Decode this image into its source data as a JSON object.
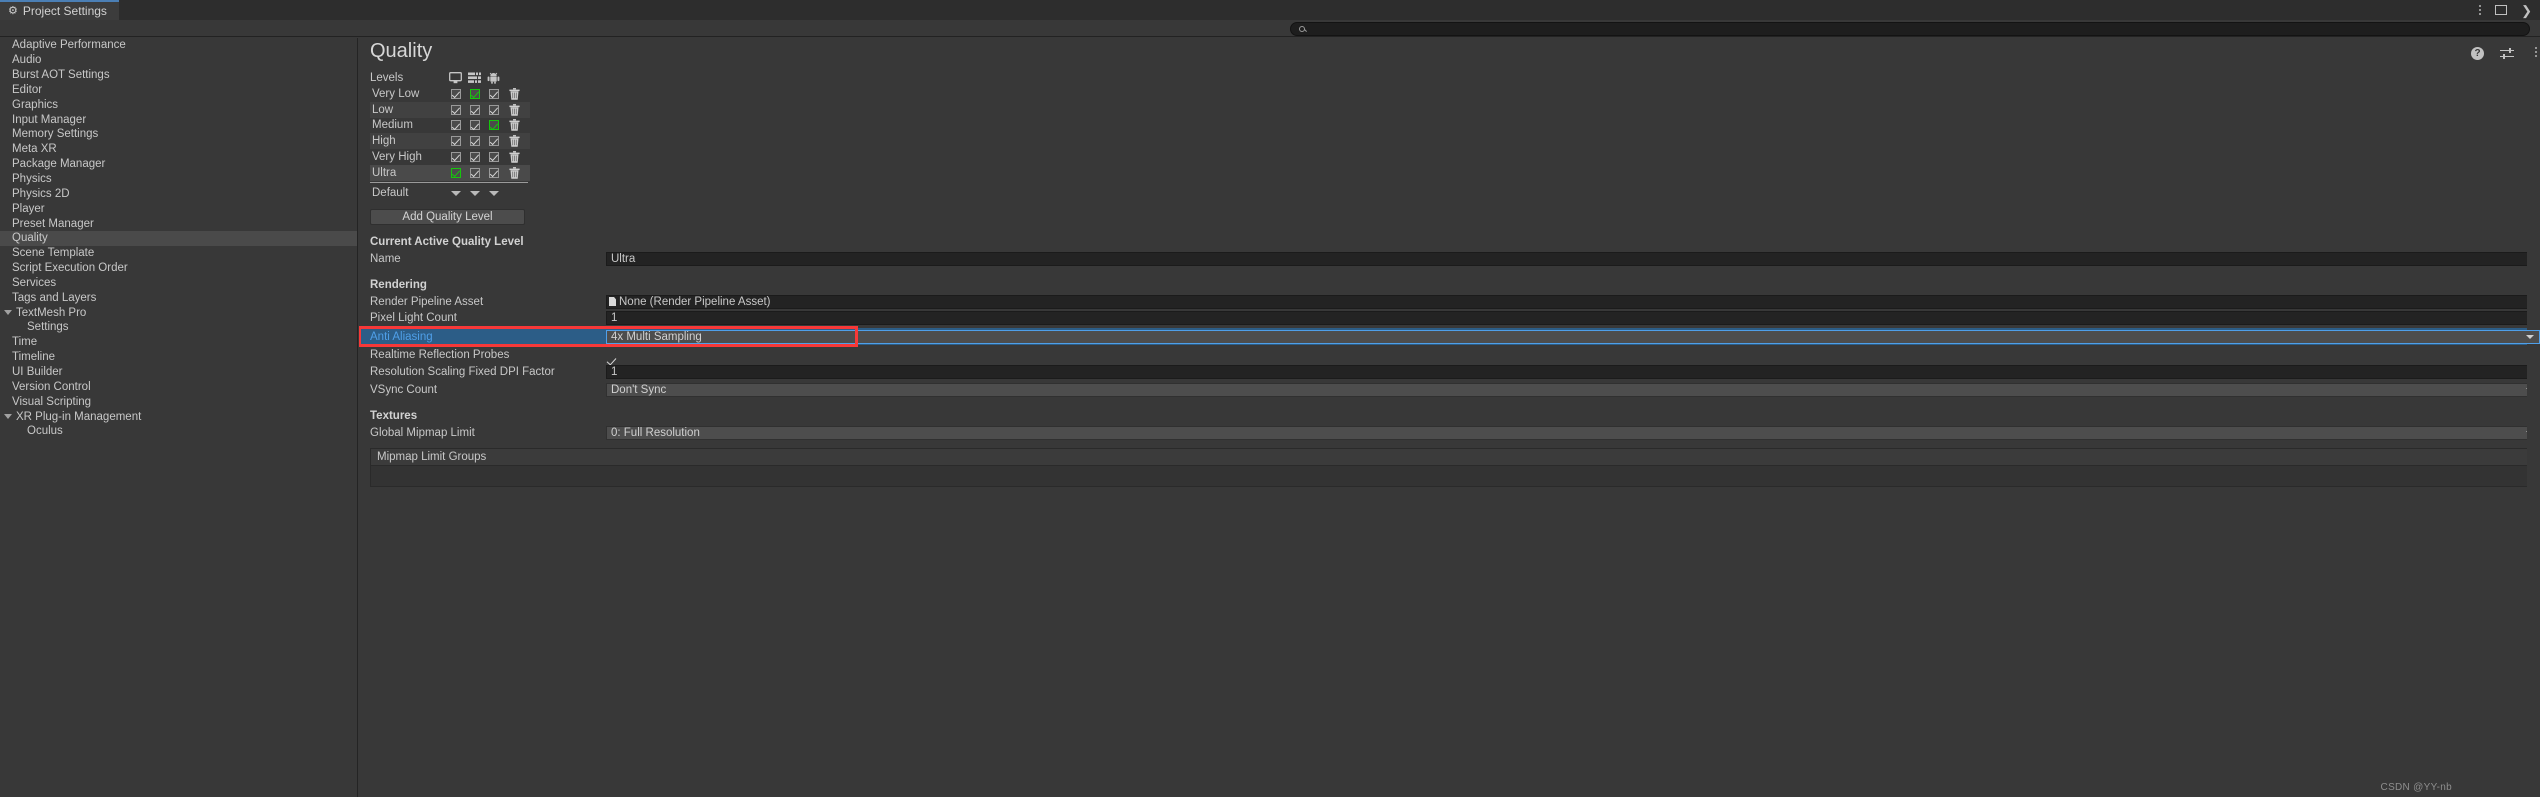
{
  "window": {
    "tab_title": "Project Settings",
    "tab_icon": "gear-icon",
    "titlebar_icons": [
      "kebab-menu-icon",
      "maximize-icon",
      "close-icon"
    ]
  },
  "search": {
    "value": "",
    "placeholder": "",
    "icon": "search-icon"
  },
  "sidebar": {
    "items": [
      {
        "label": "Adaptive Performance",
        "selected": false,
        "child": false,
        "expandable": false
      },
      {
        "label": "Audio",
        "selected": false,
        "child": false,
        "expandable": false
      },
      {
        "label": "Burst AOT Settings",
        "selected": false,
        "child": false,
        "expandable": false
      },
      {
        "label": "Editor",
        "selected": false,
        "child": false,
        "expandable": false
      },
      {
        "label": "Graphics",
        "selected": false,
        "child": false,
        "expandable": false
      },
      {
        "label": "Input Manager",
        "selected": false,
        "child": false,
        "expandable": false
      },
      {
        "label": "Memory Settings",
        "selected": false,
        "child": false,
        "expandable": false
      },
      {
        "label": "Meta XR",
        "selected": false,
        "child": false,
        "expandable": false
      },
      {
        "label": "Package Manager",
        "selected": false,
        "child": false,
        "expandable": false
      },
      {
        "label": "Physics",
        "selected": false,
        "child": false,
        "expandable": false
      },
      {
        "label": "Physics 2D",
        "selected": false,
        "child": false,
        "expandable": false
      },
      {
        "label": "Player",
        "selected": false,
        "child": false,
        "expandable": false
      },
      {
        "label": "Preset Manager",
        "selected": false,
        "child": false,
        "expandable": false
      },
      {
        "label": "Quality",
        "selected": true,
        "child": false,
        "expandable": false
      },
      {
        "label": "Scene Template",
        "selected": false,
        "child": false,
        "expandable": false
      },
      {
        "label": "Script Execution Order",
        "selected": false,
        "child": false,
        "expandable": false
      },
      {
        "label": "Services",
        "selected": false,
        "child": false,
        "expandable": false
      },
      {
        "label": "Tags and Layers",
        "selected": false,
        "child": false,
        "expandable": false
      },
      {
        "label": "TextMesh Pro",
        "selected": false,
        "child": false,
        "expandable": true
      },
      {
        "label": "Settings",
        "selected": false,
        "child": true,
        "expandable": false
      },
      {
        "label": "Time",
        "selected": false,
        "child": false,
        "expandable": false
      },
      {
        "label": "Timeline",
        "selected": false,
        "child": false,
        "expandable": false
      },
      {
        "label": "UI Builder",
        "selected": false,
        "child": false,
        "expandable": false
      },
      {
        "label": "Version Control",
        "selected": false,
        "child": false,
        "expandable": false
      },
      {
        "label": "Visual Scripting",
        "selected": false,
        "child": false,
        "expandable": false
      },
      {
        "label": "XR Plug-in Management",
        "selected": false,
        "child": false,
        "expandable": true
      },
      {
        "label": "Oculus",
        "selected": false,
        "child": true,
        "expandable": false
      }
    ]
  },
  "main": {
    "title": "Quality",
    "header_icons": [
      "help-icon",
      "preset-settings-icon",
      "kebab-menu-icon"
    ],
    "levels": {
      "label": "Levels",
      "platform_columns": [
        "standalone-monitor-icon",
        "server-icon",
        "android-icon"
      ],
      "rows": [
        {
          "name": "Very Low",
          "checks": [
            true,
            true,
            true
          ],
          "active": [
            false,
            true,
            false
          ],
          "delete_icon": "trash-icon"
        },
        {
          "name": "Low",
          "checks": [
            true,
            true,
            true
          ],
          "active": [
            false,
            false,
            false
          ],
          "delete_icon": "trash-icon"
        },
        {
          "name": "Medium",
          "checks": [
            true,
            true,
            true
          ],
          "active": [
            false,
            false,
            true
          ],
          "delete_icon": "trash-icon"
        },
        {
          "name": "High",
          "checks": [
            true,
            true,
            true
          ],
          "active": [
            false,
            false,
            false
          ],
          "delete_icon": "trash-icon"
        },
        {
          "name": "Very High",
          "checks": [
            true,
            true,
            true
          ],
          "active": [
            false,
            false,
            false
          ],
          "delete_icon": "trash-icon"
        },
        {
          "name": "Ultra",
          "checks": [
            true,
            true,
            true
          ],
          "active": [
            true,
            false,
            false
          ],
          "delete_icon": "trash-icon"
        }
      ],
      "default_label": "Default",
      "default_carets": 3
    },
    "add_quality_level_label": "Add Quality Level",
    "current_active_section": "Current Active Quality Level",
    "name_label": "Name",
    "name_value": "Ultra",
    "rendering_section": "Rendering",
    "render_pipeline_asset_label": "Render Pipeline Asset",
    "render_pipeline_asset_value": "None (Render Pipeline Asset)",
    "pixel_light_count_label": "Pixel Light Count",
    "pixel_light_count_value": "1",
    "anti_aliasing_label": "Anti Aliasing",
    "anti_aliasing_value": "4x Multi Sampling",
    "realtime_reflection_probes_label": "Realtime Reflection Probes",
    "realtime_reflection_probes_checked": true,
    "resolution_scaling_label": "Resolution Scaling Fixed DPI Factor",
    "resolution_scaling_value": "1",
    "vsync_count_label": "VSync Count",
    "vsync_count_value": "Don't Sync",
    "textures_section": "Textures",
    "global_mipmap_limit_label": "Global Mipmap Limit",
    "global_mipmap_limit_value": "0: Full Resolution",
    "mipmap_limit_groups_label": "Mipmap Limit Groups"
  },
  "watermark": "CSDN @YY-nb",
  "colors": {
    "background": "#383838",
    "panel": "#3c3c3c",
    "accent_blue": "#4b7fb5",
    "selection_blue": "#2c5d87",
    "highlight_red": "#f73838",
    "active_green": "#16c60c",
    "field_dark": "#232323",
    "dropdown": "#4d4d4d",
    "text": "#c8c8c8",
    "link_blue": "#4f9fe8"
  }
}
